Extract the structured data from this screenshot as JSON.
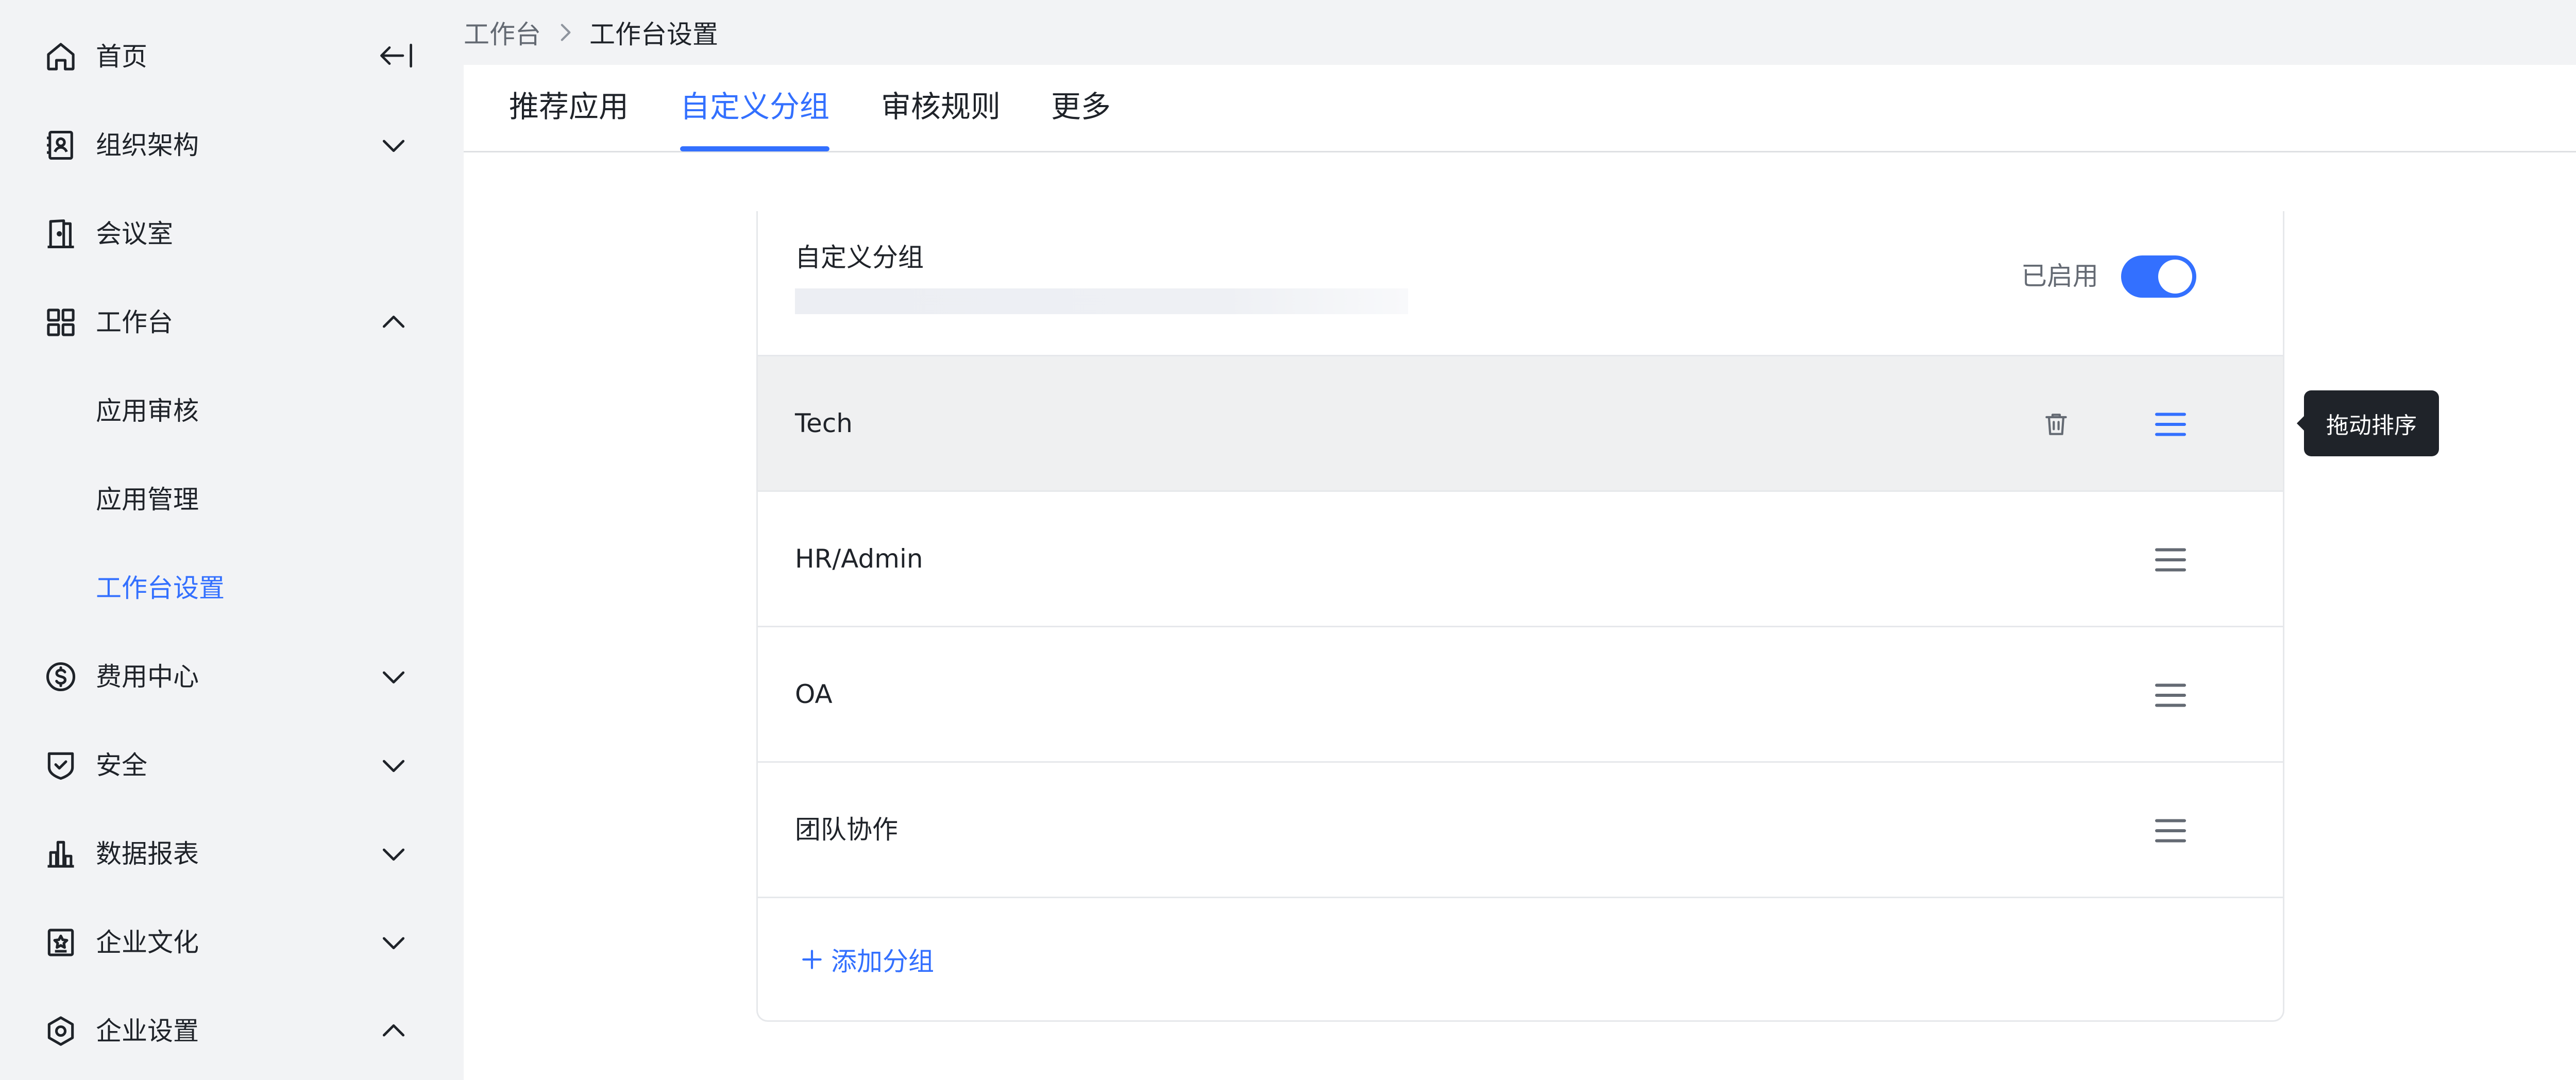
{
  "sidebar": {
    "items": [
      {
        "label": "首页",
        "icon": "home-icon"
      },
      {
        "label": "组织架构",
        "icon": "contacts-icon"
      },
      {
        "label": "会议室",
        "icon": "door-icon"
      },
      {
        "label": "工作台",
        "icon": "grid-icon"
      },
      {
        "label": "应用审核"
      },
      {
        "label": "应用管理"
      },
      {
        "label": "工作台设置"
      },
      {
        "label": "费用中心",
        "icon": "dollar-icon"
      },
      {
        "label": "安全",
        "icon": "shield-icon"
      },
      {
        "label": "数据报表",
        "icon": "bar-chart-icon"
      },
      {
        "label": "企业文化",
        "icon": "culture-icon"
      },
      {
        "label": "企业设置",
        "icon": "settings-icon"
      }
    ],
    "active_item": "工作台设置"
  },
  "breadcrumb": {
    "parent": "工作台",
    "current": "工作台设置"
  },
  "tabs": [
    "推荐应用",
    "自定义分组",
    "审核规则",
    "更多"
  ],
  "active_tab": "自定义分组",
  "card": {
    "title": "自定义分组",
    "toggle_label": "已启用",
    "toggle_on": true
  },
  "groups": [
    {
      "label": "Tech"
    },
    {
      "label": "HR/Admin"
    },
    {
      "label": "OA"
    },
    {
      "label": "团队协作"
    }
  ],
  "add_group_label": "添加分组",
  "tooltip": "拖动排序",
  "colors": {
    "accent": "#3370ff",
    "text": "#1f2329",
    "muted": "#646a73",
    "tooltip_bg": "#1f2329"
  }
}
